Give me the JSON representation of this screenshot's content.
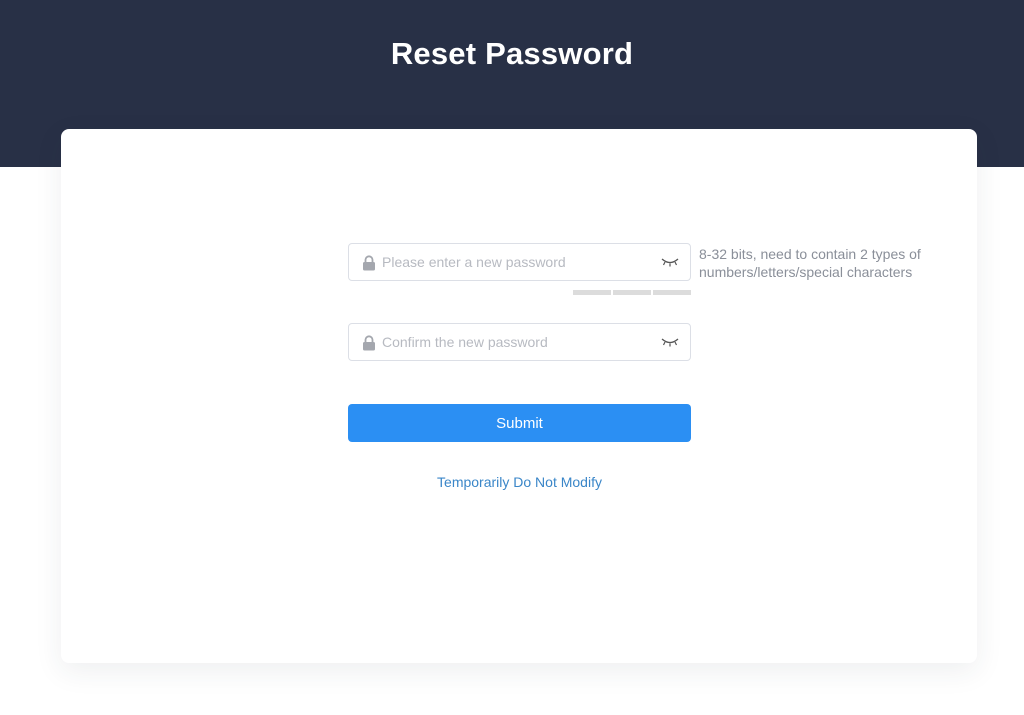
{
  "header": {
    "title": "Reset Password",
    "background_color": "#283046"
  },
  "form": {
    "new_password": {
      "placeholder": "Please enter a new password",
      "value": "",
      "leading_icon": "lock-icon",
      "trailing_icon": "eye-closed-icon"
    },
    "strength_meter": {
      "segments": 3,
      "filled": 0
    },
    "password_hint": "8-32 bits, need to contain 2 types of numbers/letters/special characters",
    "confirm_password": {
      "placeholder": "Confirm the new password",
      "value": "",
      "leading_icon": "lock-icon",
      "trailing_icon": "eye-closed-icon"
    },
    "submit_label": "Submit",
    "submit_color": "#2b8ff3",
    "skip_link": "Temporarily Do Not Modify"
  }
}
